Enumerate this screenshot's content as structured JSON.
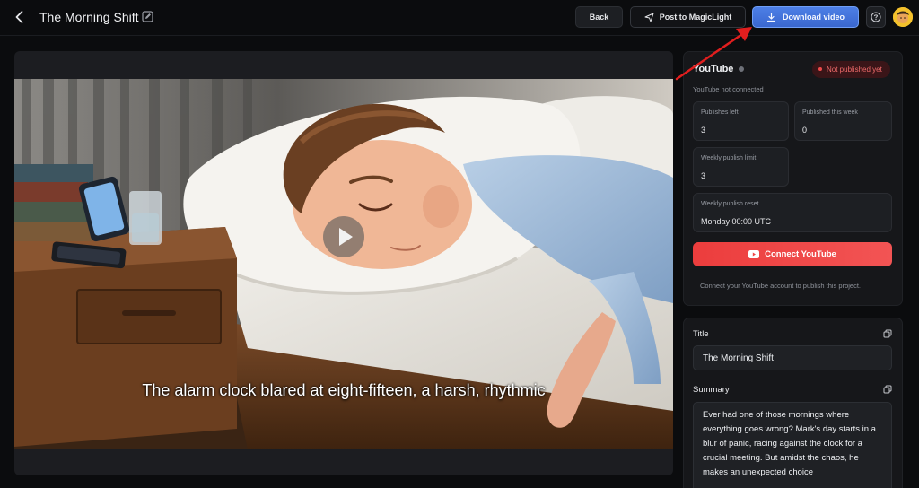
{
  "header": {
    "title": "The Morning Shift",
    "back_label": "Back",
    "post_label": "Post to MagicLight",
    "download_label": "Download video"
  },
  "video": {
    "caption": "The alarm clock blared at eight-fifteen, a harsh, rhythmic"
  },
  "youtube": {
    "title": "YouTube",
    "status": "Not published yet",
    "connection_status": "YouTube not connected",
    "stats": [
      {
        "label": "Publishes left",
        "value": "3"
      },
      {
        "label": "Published this week",
        "value": "0"
      },
      {
        "label": "Weekly publish limit",
        "value": "3"
      },
      {
        "label": "Weekly publish reset",
        "value": "Monday 00:00 UTC"
      }
    ],
    "connect_label": "Connect YouTube",
    "connect_note": "Connect your YouTube account to publish this project."
  },
  "details": {
    "title_label": "Title",
    "title_value": "The Morning Shift",
    "summary_label": "Summary",
    "summary_value": "Ever had one of those mornings where everything goes wrong? Mark's day starts in a blur of panic, racing against the clock for a crucial meeting. But amidst the chaos, he makes an unexpected choice"
  },
  "colors": {
    "background": "#0b0c0e",
    "panel": "#16171a",
    "accent_blue": "#3f6fdc",
    "youtube_red": "#ee4444",
    "annotation_arrow": "#e01e1e"
  }
}
